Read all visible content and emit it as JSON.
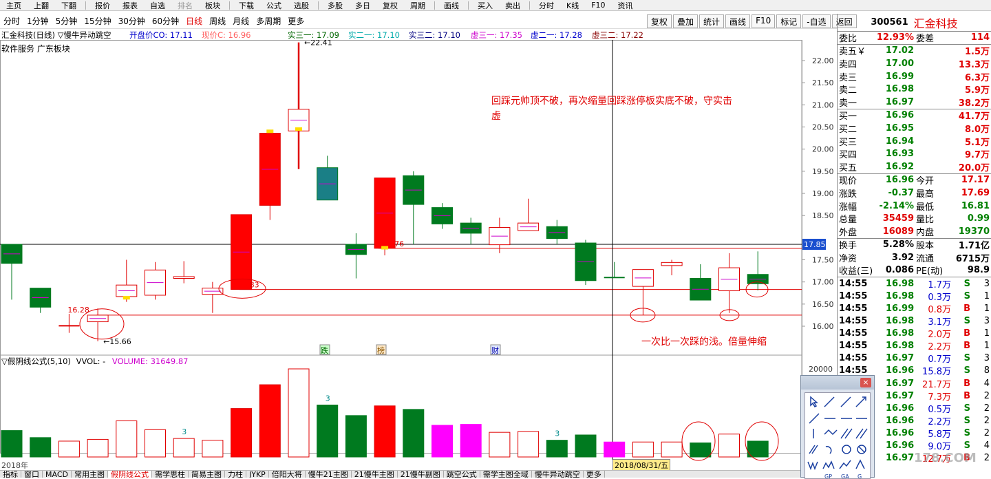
{
  "menubar": {
    "items": [
      "主页",
      "上翻",
      "下翻",
      "报价",
      "报表",
      "自选",
      "排名",
      "板块",
      "下载",
      "公式",
      "选股",
      "多股",
      "多日",
      "复权",
      "周期",
      "画线",
      "买入",
      "卖出",
      "分时",
      "K线",
      "F10",
      "资讯"
    ]
  },
  "periods": {
    "items": [
      "分时",
      "1分钟",
      "5分钟",
      "15分钟",
      "30分钟",
      "60分钟",
      "日线",
      "周线",
      "月线",
      "多周期",
      "更多"
    ],
    "active": "日线"
  },
  "toolbar_right": [
    "复权",
    "叠加",
    "统计",
    "画线",
    "F10",
    "标记",
    "-自选",
    "返回"
  ],
  "info": {
    "stock_title": "汇金科技(日线) ▽慢牛异动跳空",
    "open_price": "开盘价CO: 17.11",
    "current_price": "现价C: 16.96",
    "s3_1": "实三一: 17.09",
    "s2_1": "实二一: 17.10",
    "s3_2": "实三二: 17.10",
    "x3_1": "虚三一: 17.35",
    "x2_1": "虚二一: 17.28",
    "x3_2": "虚三二: 17.22",
    "tags": "软件服务   广东板块"
  },
  "annotations": {
    "main": "回踩元帅顶不破，再次缩量回踩涨停板实底不破，守实击虚",
    "bottom": "一次比一次踩的浅。倍量伸缩"
  },
  "sub_info": {
    "label": "▽假阴线公式(5,10)",
    "vol_label": "VVOL: -",
    "volume": "VOLUME: 31649.87"
  },
  "date_start": "2018年",
  "date_cursor": "2018/08/31/五",
  "bottom_tabs": [
    "指标",
    "窗口",
    "MACD",
    "常用主图",
    "假阴线公式",
    "需学思柱",
    "简易主图",
    "力柱",
    "JYKP",
    "倍阳大将",
    "慢牛21主图",
    "21慢牛主图",
    "21慢牛副图",
    "跳空公式",
    "需学主图全域",
    "慢牛异动跳空",
    "更多"
  ],
  "bottom_active": "假阴线公式",
  "chart_data": {
    "type": "candlestick",
    "y_ticks": [
      "22.00",
      "21.50",
      "21.00",
      "20.50",
      "20.00",
      "19.50",
      "19.00",
      "18.50",
      "17.85",
      "17.50",
      "17.00",
      "16.50",
      "16.00"
    ],
    "vol_tick": "20000",
    "candles": [
      {
        "o": 17.42,
        "c": 17.85,
        "h": 17.85,
        "l": 16.6,
        "dir": "down"
      },
      {
        "o": 16.43,
        "c": 16.86,
        "h": 16.86,
        "l": 16.3,
        "dir": "down"
      },
      {
        "o": 16.01,
        "c": 16.0,
        "h": 16.28,
        "l": 15.85,
        "dir": "flat"
      },
      {
        "o": 16.1,
        "c": 16.25,
        "h": 16.4,
        "l": 15.66,
        "dir": "up"
      },
      {
        "o": 16.67,
        "c": 16.93,
        "h": 17.5,
        "l": 16.55,
        "dir": "up"
      },
      {
        "o": 16.7,
        "c": 17.27,
        "h": 17.45,
        "l": 16.6,
        "dir": "up"
      },
      {
        "o": 17.08,
        "c": 17.12,
        "h": 17.47,
        "l": 16.97,
        "dir": "up"
      },
      {
        "o": 16.72,
        "c": 16.86,
        "h": 17.0,
        "l": 16.3,
        "dir": "up"
      },
      {
        "o": 16.83,
        "c": 18.52,
        "h": 18.52,
        "l": 16.83,
        "dir": "up-fill"
      },
      {
        "o": 18.73,
        "c": 20.36,
        "h": 20.36,
        "l": 18.4,
        "dir": "up-fill"
      },
      {
        "o": 20.41,
        "c": 20.9,
        "h": 22.41,
        "l": 19.55,
        "dir": "up"
      },
      {
        "o": 19.58,
        "c": 18.85,
        "h": 19.85,
        "l": 18.85,
        "dir": "down-teal"
      },
      {
        "o": 17.85,
        "c": 17.62,
        "h": 18.1,
        "l": 17.08,
        "dir": "down"
      },
      {
        "o": 17.76,
        "c": 19.35,
        "h": 19.35,
        "l": 17.6,
        "dir": "up-fill"
      },
      {
        "o": 19.4,
        "c": 18.75,
        "h": 19.5,
        "l": 17.85,
        "dir": "down"
      },
      {
        "o": 18.68,
        "c": 18.31,
        "h": 18.78,
        "l": 18.2,
        "dir": "down"
      },
      {
        "o": 18.33,
        "c": 18.1,
        "h": 18.45,
        "l": 17.85,
        "dir": "down"
      },
      {
        "o": 17.84,
        "c": 18.23,
        "h": 18.45,
        "l": 17.65,
        "dir": "up"
      },
      {
        "o": 18.16,
        "c": 18.33,
        "h": 18.88,
        "l": 18.16,
        "dir": "up"
      },
      {
        "o": 18.25,
        "c": 17.98,
        "h": 18.4,
        "l": 17.85,
        "dir": "down"
      },
      {
        "o": 17.88,
        "c": 17.03,
        "h": 17.95,
        "l": 16.93,
        "dir": "down"
      },
      {
        "o": 17.1,
        "c": 17.1,
        "h": 17.45,
        "l": 17.1,
        "dir": "flat-green"
      },
      {
        "o": 16.9,
        "c": 17.28,
        "h": 17.28,
        "l": 16.25,
        "dir": "up"
      },
      {
        "o": 17.37,
        "c": 17.44,
        "h": 17.5,
        "l": 17.15,
        "dir": "up"
      },
      {
        "o": 17.08,
        "c": 16.59,
        "h": 17.4,
        "l": 16.59,
        "dir": "down"
      },
      {
        "o": 16.8,
        "c": 17.32,
        "h": 17.65,
        "l": 16.3,
        "dir": "up"
      },
      {
        "o": 17.17,
        "c": 16.96,
        "h": 17.69,
        "l": 16.81,
        "dir": "down"
      }
    ],
    "volumes": [
      {
        "v": 0.3,
        "c": "green"
      },
      {
        "v": 0.22,
        "c": "green"
      },
      {
        "v": 0.18,
        "c": "red-hollow"
      },
      {
        "v": 0.2,
        "c": "red-hollow"
      },
      {
        "v": 0.41,
        "c": "red-hollow"
      },
      {
        "v": 0.31,
        "c": "red-hollow"
      },
      {
        "v": 0.21,
        "c": "red-hollow"
      },
      {
        "v": 0.19,
        "c": "red-hollow"
      },
      {
        "v": 0.55,
        "c": "red"
      },
      {
        "v": 0.82,
        "c": "red"
      },
      {
        "v": 1.0,
        "c": "red-hollow"
      },
      {
        "v": 0.59,
        "c": "green"
      },
      {
        "v": 0.47,
        "c": "green"
      },
      {
        "v": 0.58,
        "c": "red"
      },
      {
        "v": 0.54,
        "c": "green"
      },
      {
        "v": 0.36,
        "c": "magenta"
      },
      {
        "v": 0.37,
        "c": "magenta"
      },
      {
        "v": 0.28,
        "c": "red-hollow"
      },
      {
        "v": 0.29,
        "c": "red-hollow"
      },
      {
        "v": 0.19,
        "c": "green"
      },
      {
        "v": 0.25,
        "c": "green"
      },
      {
        "v": 0.17,
        "c": "magenta"
      },
      {
        "v": 0.17,
        "c": "red-hollow"
      },
      {
        "v": 0.17,
        "c": "red-hollow"
      },
      {
        "v": 0.16,
        "c": "green"
      },
      {
        "v": 0.26,
        "c": "red-hollow"
      },
      {
        "v": 0.18,
        "c": "green"
      }
    ],
    "price_labels": {
      "low": "15.66",
      "first": "16.28",
      "high": "22.41",
      "left_mark": "83",
      "mid_mark": "76"
    },
    "event_tags": [
      "跌",
      "榜",
      "财"
    ],
    "vol_marks": [
      "3",
      "3",
      "3"
    ]
  },
  "panel": {
    "code": "300561",
    "name": "汇金科技",
    "weibi_label": "委比",
    "weibi": "12.93%",
    "weicha_label": "委差",
    "weicha": "114",
    "sell": [
      {
        "label": "卖五￥",
        "price": "17.02",
        "vol": "1.5万"
      },
      {
        "label": "卖四",
        "price": "17.00",
        "vol": "13.3万"
      },
      {
        "label": "卖三",
        "price": "16.99",
        "vol": "6.3万"
      },
      {
        "label": "卖二",
        "price": "16.98",
        "vol": "5.9万"
      },
      {
        "label": "卖一",
        "price": "16.97",
        "vol": "38.2万"
      }
    ],
    "buy": [
      {
        "label": "买一",
        "price": "16.96",
        "vol": "41.7万"
      },
      {
        "label": "买二",
        "price": "16.95",
        "vol": "8.0万"
      },
      {
        "label": "买三",
        "price": "16.94",
        "vol": "5.1万"
      },
      {
        "label": "买四",
        "price": "16.93",
        "vol": "9.7万"
      },
      {
        "label": "买五",
        "price": "16.92",
        "vol": "20.0万"
      }
    ],
    "quote": [
      {
        "l1": "现价",
        "v1": "16.96",
        "l2": "今开",
        "v2": "17.17",
        "c1": "grn",
        "c2": "red"
      },
      {
        "l1": "涨跌",
        "v1": "-0.37",
        "l2": "最高",
        "v2": "17.69",
        "c1": "grn",
        "c2": "red"
      },
      {
        "l1": "涨幅",
        "v1": "-2.14%",
        "l2": "最低",
        "v2": "16.81",
        "c1": "grn",
        "c2": "grn"
      },
      {
        "l1": "总量",
        "v1": "35459",
        "l2": "量比",
        "v2": "0.99",
        "c1": "red",
        "c2": "grn"
      },
      {
        "l1": "外盘",
        "v1": "16089",
        "l2": "内盘",
        "v2": "19370",
        "c1": "red",
        "c2": "grn"
      }
    ],
    "fin": [
      {
        "l1": "换手",
        "v1": "5.28%",
        "l2": "股本",
        "v2": "1.71亿"
      },
      {
        "l1": "净资",
        "v1": "3.92",
        "l2": "流通",
        "v2": "6715万"
      },
      {
        "l1": "收益(三)",
        "v1": "0.086",
        "l2": "PE(动)",
        "v2": "98.9"
      }
    ],
    "ticks": [
      {
        "t": "14:55",
        "p": "16.98",
        "v": "1.7万",
        "s": "S",
        "n": "3"
      },
      {
        "t": "14:55",
        "p": "16.98",
        "v": "0.3万",
        "s": "S",
        "n": "1"
      },
      {
        "t": "14:55",
        "p": "16.99",
        "v": "0.8万",
        "s": "B",
        "n": "1"
      },
      {
        "t": "14:55",
        "p": "16.98",
        "v": "3.1万",
        "s": "S",
        "n": "3"
      },
      {
        "t": "14:55",
        "p": "16.98",
        "v": "2.0万",
        "s": "B",
        "n": "1"
      },
      {
        "t": "14:55",
        "p": "16.98",
        "v": "2.2万",
        "s": "B",
        "n": "1"
      },
      {
        "t": "14:55",
        "p": "16.97",
        "v": "0.7万",
        "s": "S",
        "n": "3"
      },
      {
        "t": "14:55",
        "p": "16.96",
        "v": "15.8万",
        "s": "S",
        "n": "8"
      },
      {
        "t": "14:55",
        "p": "16.97",
        "v": "21.7万",
        "s": "B",
        "n": "4"
      },
      {
        "t": "14:55",
        "p": "16.97",
        "v": "7.3万",
        "s": "B",
        "n": "2"
      },
      {
        "t": "14:55",
        "p": "16.96",
        "v": "0.5万",
        "s": "S",
        "n": "2"
      },
      {
        "t": "14:55",
        "p": "16.96",
        "v": "2.2万",
        "s": "S",
        "n": "2"
      },
      {
        "t": "14:55",
        "p": "16.96",
        "v": "5.8万",
        "s": "S",
        "n": "2"
      },
      {
        "t": "14:55",
        "p": "16.96",
        "v": "9.0万",
        "s": "S",
        "n": "4"
      },
      {
        "t": "14:55",
        "p": "16.97",
        "v": "12.7万",
        "s": "B",
        "n": "2"
      }
    ]
  },
  "toolbox": {
    "close": "×"
  },
  "watermark": "178.COM"
}
